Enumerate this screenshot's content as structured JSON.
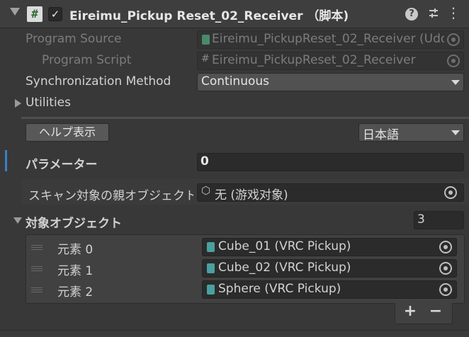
{
  "header": {
    "title": "Eireimu_Pickup Reset_02_Receiver （脚本)",
    "enabled": true
  },
  "program_source": {
    "label": "Program Source",
    "value": "Eireimu_PickupReset_02_Receiver (Udo"
  },
  "program_script": {
    "label": "Program Script",
    "value": "Eireimu_PickupReset_02_Receiver"
  },
  "sync_method": {
    "label": "Synchronization Method",
    "value": "Continuous"
  },
  "utilities": {
    "label": "Utilities"
  },
  "help_button": {
    "label": "ヘルプ表示"
  },
  "language_select": {
    "value": "日本語"
  },
  "parameter": {
    "label": "パラメーター",
    "value": "0"
  },
  "scan_parent": {
    "label": "スキャン対象の親オブジェクト",
    "value": "无 (游戏对象)"
  },
  "targets": {
    "label": "対象オブジェクト",
    "count": "3",
    "items": [
      {
        "label": "元素 0",
        "value": "Cube_01 (VRC Pickup)"
      },
      {
        "label": "元素 1",
        "value": "Cube_02 (VRC Pickup)"
      },
      {
        "label": "元素 2",
        "value": "Sphere (VRC Pickup)"
      }
    ],
    "add_label": "+",
    "remove_label": "−"
  },
  "colors": {
    "accent_bar": "#3a7fc4",
    "asset_icon": "#4aa0a0"
  }
}
